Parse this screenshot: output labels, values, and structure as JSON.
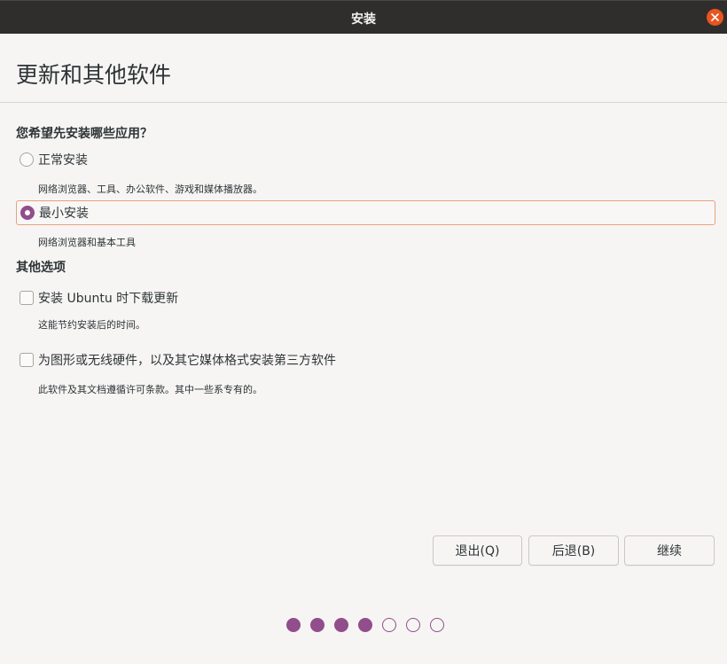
{
  "window": {
    "title": "安装",
    "close_icon": "close-icon"
  },
  "header": {
    "page_title": "更新和其他软件"
  },
  "install_type": {
    "question": "您希望先安装哪些应用？",
    "options": [
      {
        "label": "正常安装",
        "description": "网络浏览器、工具、办公软件、游戏和媒体播放器。",
        "selected": false
      },
      {
        "label": "最小安装",
        "description": "网络浏览器和基本工具",
        "selected": true
      }
    ]
  },
  "other_options": {
    "title": "其他选项",
    "items": [
      {
        "label": "安装 Ubuntu 时下载更新",
        "description": "这能节约安装后的时间。",
        "checked": false
      },
      {
        "label": "为图形或无线硬件，以及其它媒体格式安装第三方软件",
        "description": "此软件及其文档遵循许可条款。其中一些系专有的。",
        "checked": false
      }
    ]
  },
  "buttons": {
    "quit": "退出(Q)",
    "back": "后退(B)",
    "continue": "继续"
  },
  "progress": {
    "total_steps": 7,
    "completed_steps": 4
  },
  "colors": {
    "accent": "#924d8b",
    "close": "#e95420",
    "selection_border": "#e9a07d",
    "titlebar": "#302e2d"
  }
}
